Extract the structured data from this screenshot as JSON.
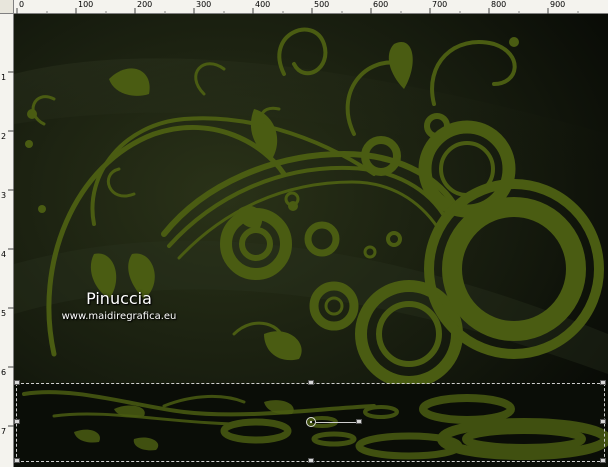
{
  "ruler": {
    "top_ticks": [
      "0",
      "100",
      "200",
      "300",
      "400",
      "500",
      "600",
      "700",
      "800",
      "900"
    ],
    "left_ticks": [
      "1",
      "2",
      "3",
      "4",
      "5",
      "6",
      "7"
    ]
  },
  "canvas": {
    "watermark_title": "Pinuccia",
    "watermark_url": "www.maidiregrafica.eu",
    "artwork": "dark green swirl, leaves and circles decoration with mirrored reflection",
    "accent_color": "#4a5c12",
    "background_color": "#0f130b"
  },
  "selection": {
    "state": "active marquee with transform handles"
  }
}
